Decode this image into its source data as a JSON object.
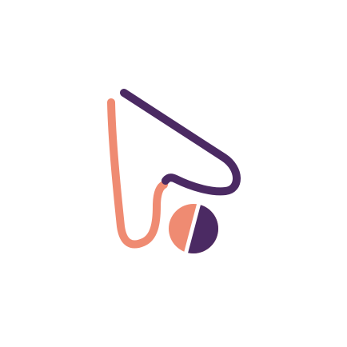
{
  "logo": {
    "icon": "cursor-pointer-logo-icon",
    "colors": {
      "coral": "#ef8b72",
      "purple": "#4b2a63",
      "background": "#ffffff"
    }
  }
}
